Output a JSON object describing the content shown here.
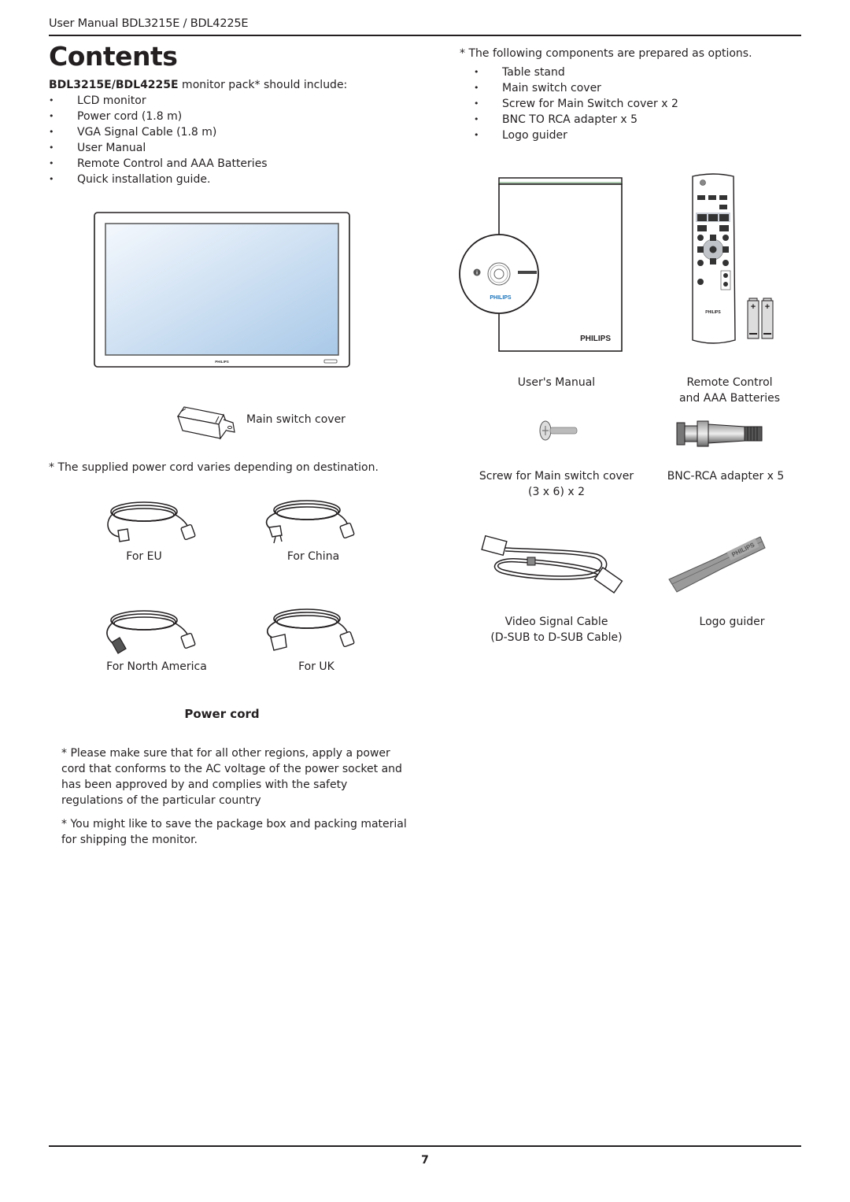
{
  "header": {
    "running_title": "User Manual BDL3215E / BDL4225E",
    "page_title": "Contents",
    "page_number": "7"
  },
  "pack": {
    "model": "BDL3215E/BDL4225E",
    "intro_suffix": " monitor pack* should include:",
    "items": [
      "LCD monitor",
      "Power cord (1.8 m)",
      "VGA Signal Cable (1.8 m)",
      "User Manual",
      "Remote Control and AAA Batteries",
      "Quick installation guide."
    ]
  },
  "options": {
    "note": "* The following components are prepared as options.",
    "items": [
      "Table stand",
      "Main switch cover",
      "Screw for Main Switch cover x 2",
      "BNC TO RCA adapter x 5",
      "Logo guider"
    ]
  },
  "figures": {
    "monitor_brand": "PHILIPS",
    "main_switch_cover": "Main switch cover",
    "power_cord_note": "* The supplied power cord varies depending on destination.",
    "cords": [
      "For EU",
      "For China",
      "For North America",
      "For UK"
    ],
    "users_manual": "User's Manual",
    "remote_line1": "Remote Control",
    "remote_line2": "and AAA Batteries",
    "screw_line1": "Screw for Main switch cover",
    "screw_line2": "(3 x 6) x 2",
    "bnc": "BNC-RCA adapter x 5",
    "vga_line1": "Video Signal Cable",
    "vga_line2": "(D-SUB to D-SUB Cable)",
    "logo_guider": "Logo guider",
    "manual_brand": "PHILIPS",
    "cd_brand": "PHILIPS",
    "remote_brand": "PHILIPS",
    "logo_brand": "PHILIPS"
  },
  "power_cord_section": {
    "title": "Power cord",
    "para1": "* Please make sure that for all other regions, apply a power cord that conforms to the AC voltage of the power socket and has been approved by and complies with the safety regulations of the particular country",
    "para2": "* You might like to save the package box and packing material for shipping the monitor."
  },
  "colors": {
    "text": "#231f20",
    "philips_blue": "#1b75bc",
    "screen_light": "#f4f8fd",
    "screen_dark": "#a9c9e8"
  }
}
